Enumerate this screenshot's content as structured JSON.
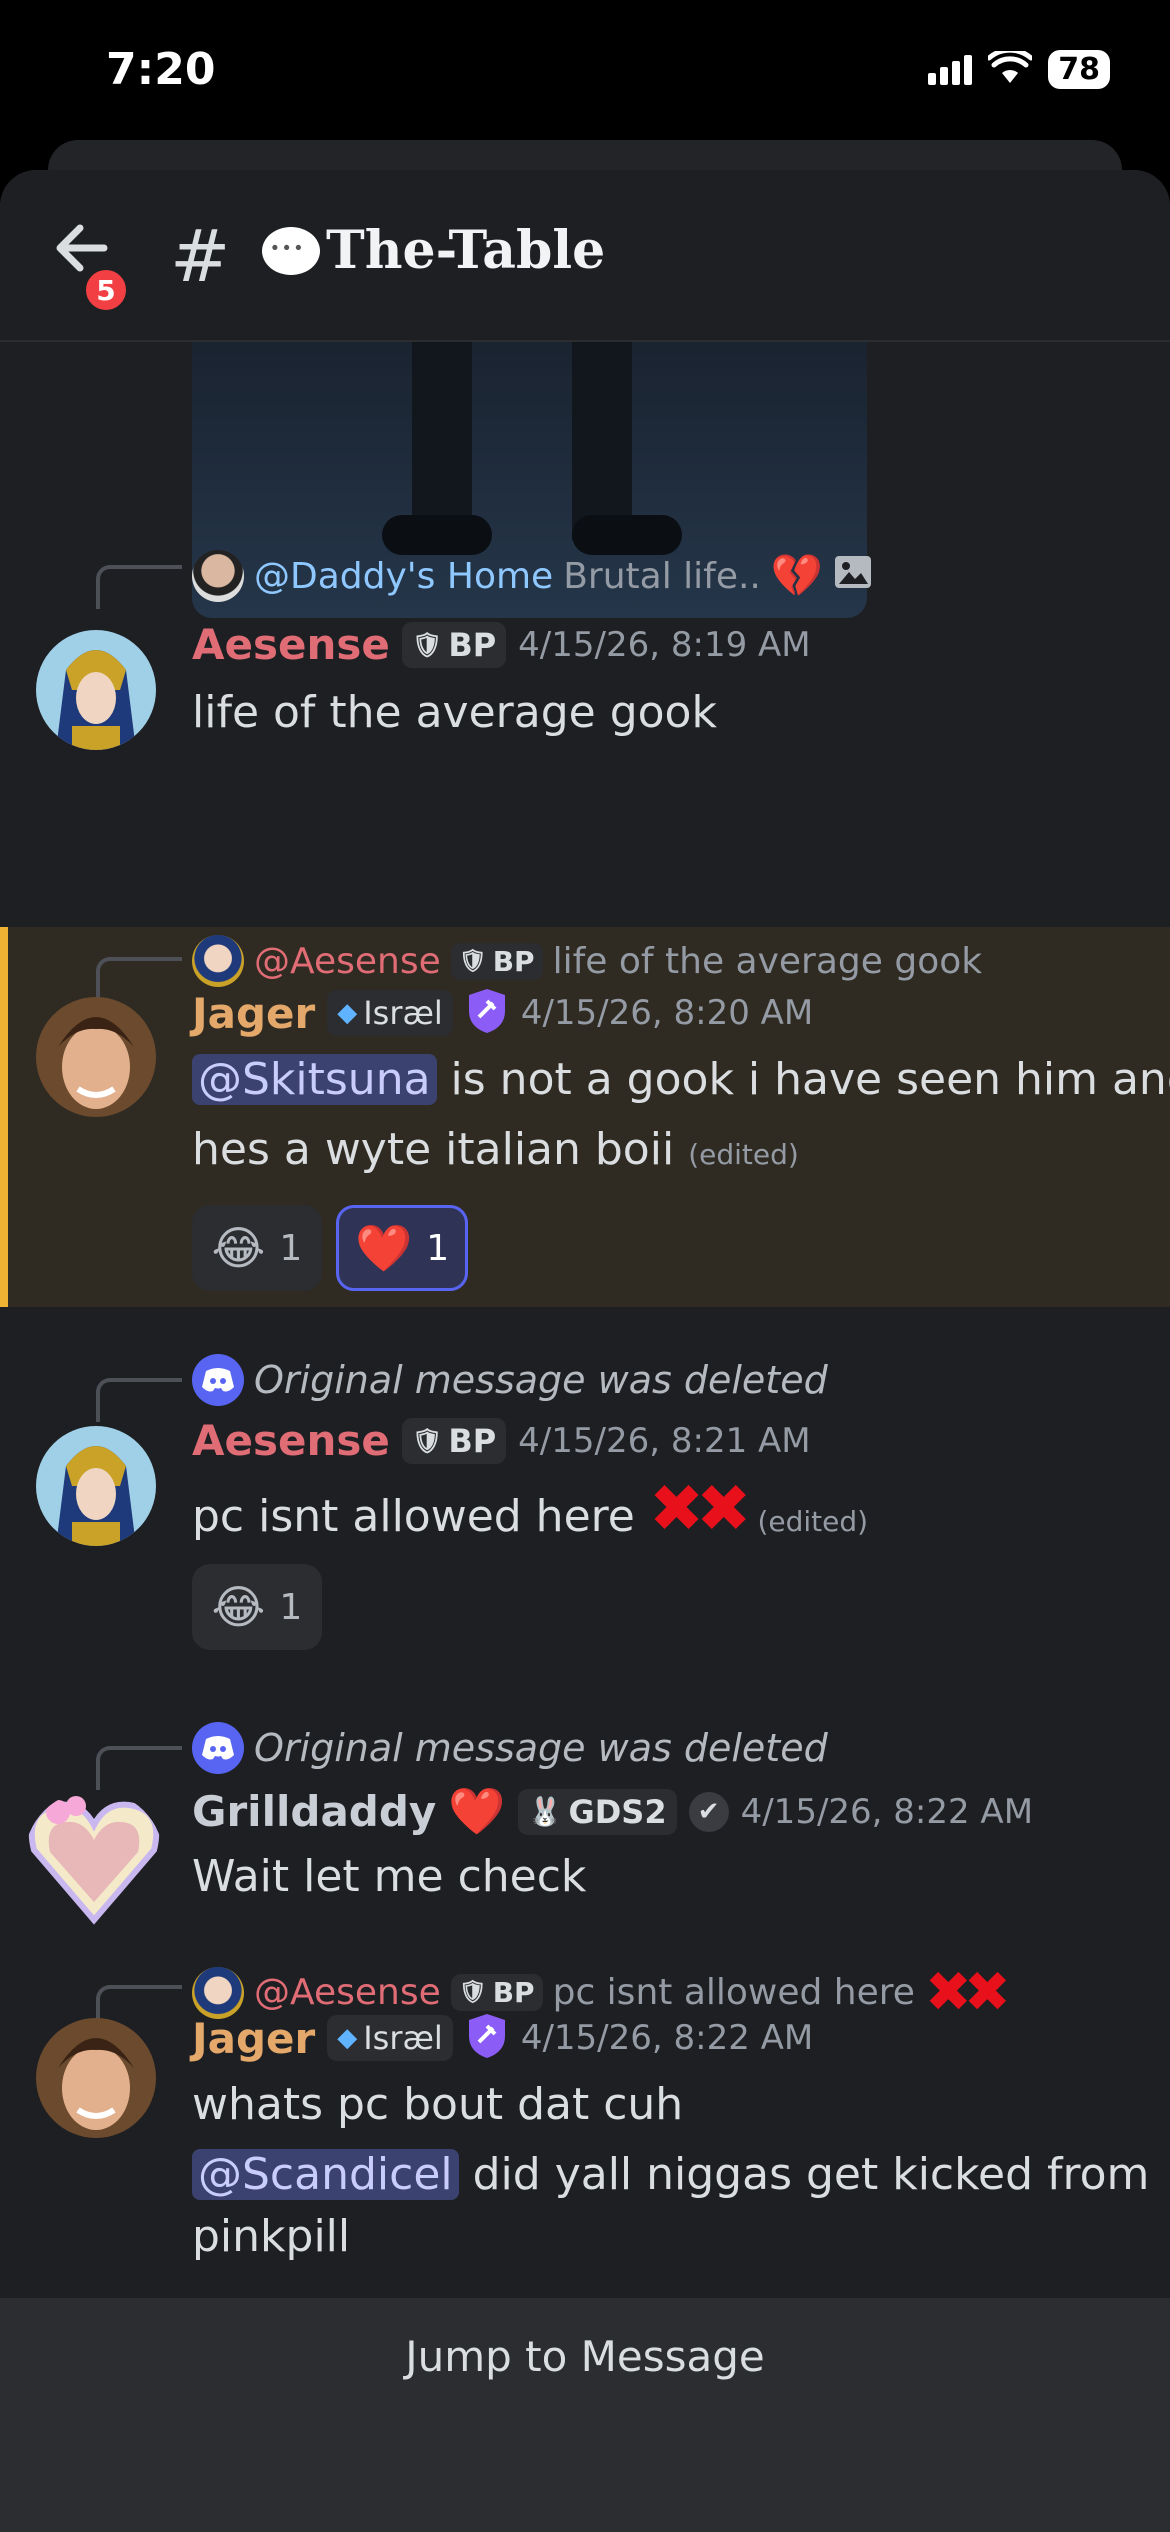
{
  "status": {
    "time": "7:20",
    "battery": "78"
  },
  "header": {
    "back_badge": "5",
    "hash": "#",
    "channel_name": "The-Table"
  },
  "messages": [
    {
      "reply": {
        "mention": "@Daddy's Home",
        "preview": "Brutal life.."
      },
      "author": "Aesense",
      "tag": "BP",
      "timestamp": "4/15/26, 8:19 AM",
      "text": "life of the average gook"
    },
    {
      "reply": {
        "mention": "@Aesense",
        "tag": "BP",
        "preview": "life of the average gook"
      },
      "author": "Jager",
      "tag": "Isrӕl",
      "timestamp": "4/15/26, 8:20 AM",
      "mention": "@Skitsuna",
      "text_line1": "is not a gook i have seen him and",
      "text_line2": "hes a wyte italian boii",
      "edited": "(edited)",
      "reactions": [
        {
          "emoji": "😂",
          "count": "1"
        },
        {
          "emoji": "❤️",
          "count": "1"
        }
      ]
    },
    {
      "reply": {
        "deleted": "Original message was deleted"
      },
      "author": "Aesense",
      "tag": "BP",
      "timestamp": "4/15/26, 8:21 AM",
      "text": "pc isnt allowed here",
      "edited": "(edited)",
      "reactions": [
        {
          "emoji": "😂",
          "count": "1"
        }
      ]
    },
    {
      "reply": {
        "deleted": "Original message was deleted"
      },
      "author": "Grilldaddy",
      "tag": "GDS2",
      "timestamp": "4/15/26, 8:22 AM",
      "text": "Wait let me check"
    },
    {
      "reply": {
        "mention": "@Aesense",
        "tag": "BP",
        "preview": "pc isnt allowed here"
      },
      "author": "Jager",
      "tag": "Isrӕl",
      "timestamp": "4/15/26, 8:22 AM",
      "text": "whats pc bout dat cuh",
      "mention": "@Scandicel",
      "text_line2": "did yall niggas get kicked from",
      "text_line3": "pinkpill"
    }
  ],
  "footer": {
    "jump_label": "Jump to Message"
  },
  "colors": {
    "aesense": "#e06c75",
    "jager": "#e5a86b",
    "grilldaddy": "#c9ced6",
    "mention_daddy": "#8fc8ff",
    "highlight_bar": "#f0b232"
  }
}
